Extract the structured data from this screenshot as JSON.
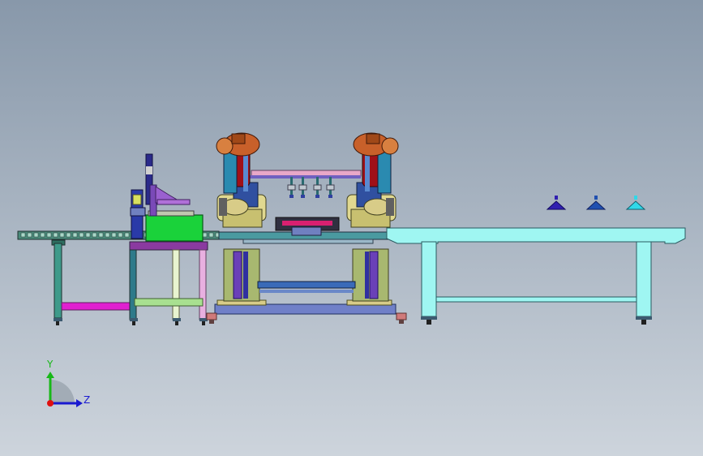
{
  "viewport": {
    "background_top": "#8898aa",
    "background_bottom": "#cdd4dc"
  },
  "triad": {
    "y_label": "Y",
    "z_label": "Z",
    "y_color": "#18b818",
    "z_color": "#1a1ad0",
    "origin_color": "#e01010"
  },
  "colors": {
    "robot_orange": "#c8602a",
    "robot_red": "#a01018",
    "robot_base": "#d8cc88",
    "table_cyan": "#9ff6f2",
    "conveyor_green": "#1ad23a",
    "magenta": "#e020d0",
    "frame_teal": "#3e9a8a",
    "beam_blue": "#5a6ad0",
    "marker_navy": "#3020b0",
    "marker_blue": "#2050b0",
    "marker_cyan": "#30d8e8"
  },
  "icons": [
    "coordinate-triad-icon",
    "part-marker-icon"
  ]
}
